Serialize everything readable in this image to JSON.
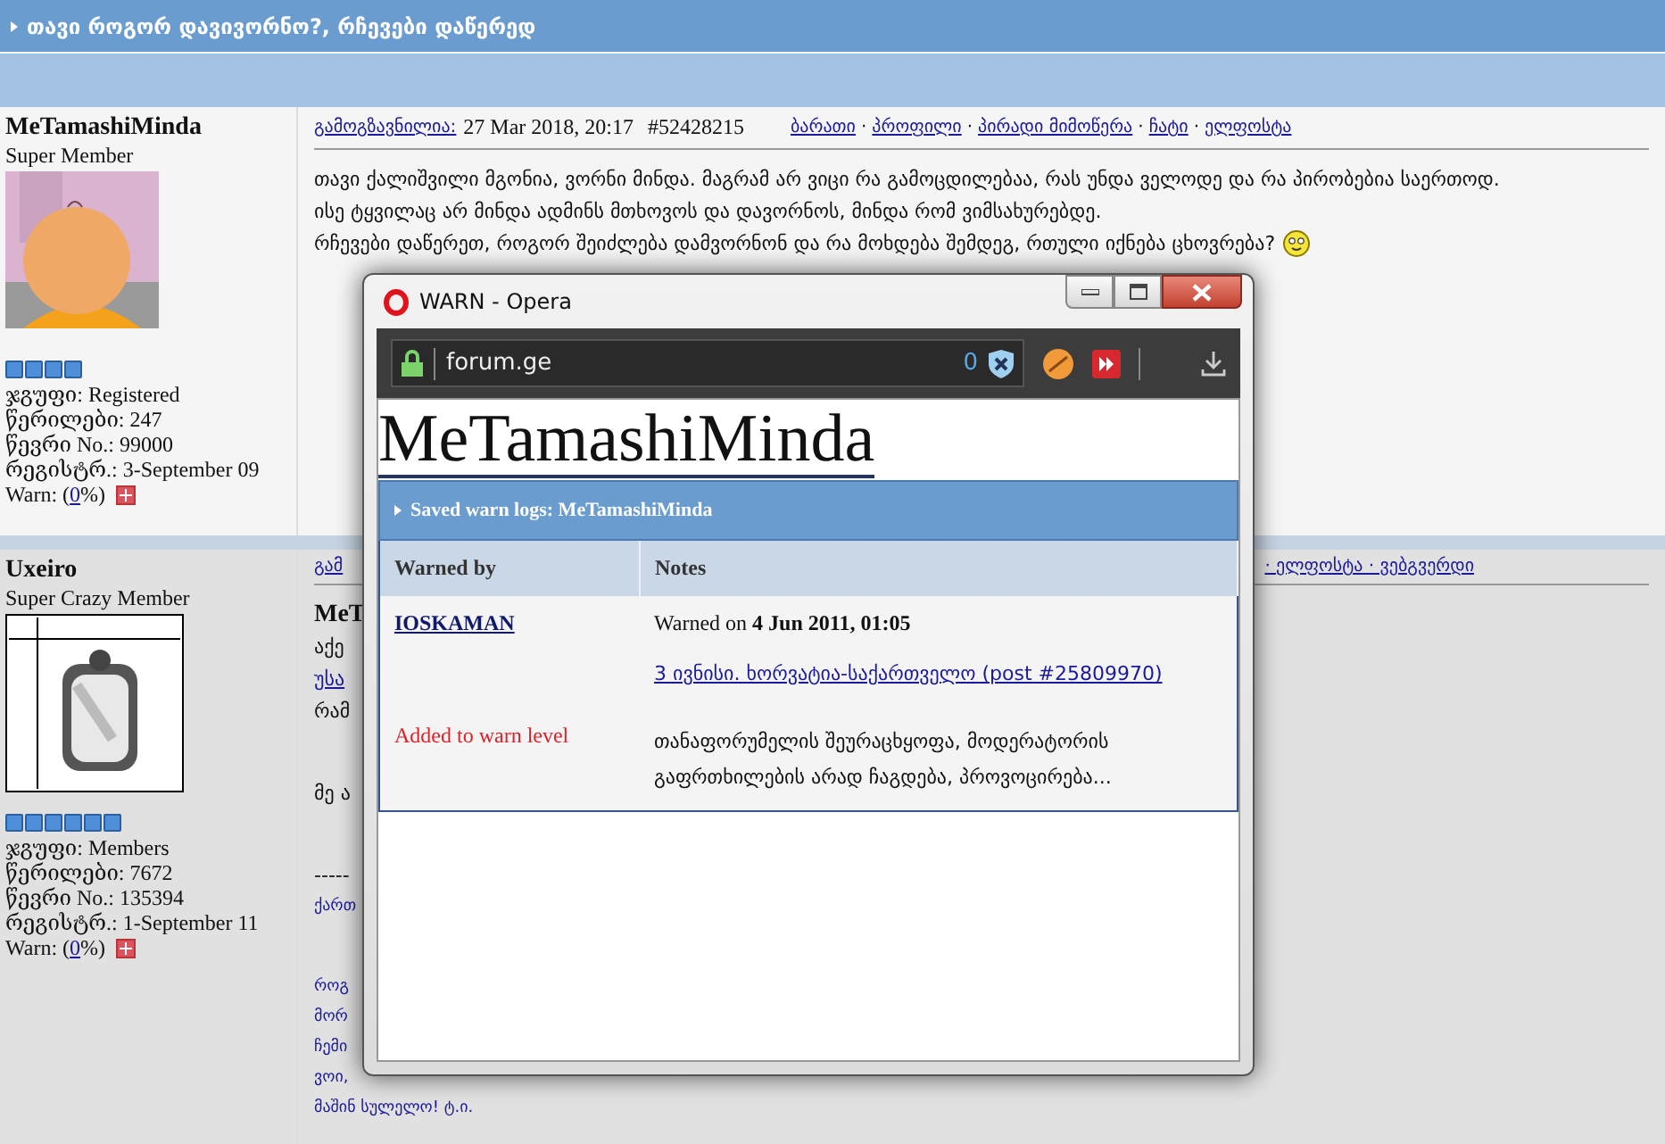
{
  "topic_title": "თავი როგორ დავივორნო?, რჩევები დაწერედ",
  "posts": [
    {
      "author": "MeTamashiMinda",
      "rank": "Super Member",
      "avatar": {
        "kind": "picture"
      },
      "rank_pips": {
        "stars": 4
      },
      "info": [
        "ჯგუფი: Registered",
        "წერილები: 247",
        "წევრი No.: 99000",
        "რეგისტრ.: 3-September 09"
      ],
      "warn": {
        "label": "Warn: (",
        "value": "0",
        "suffix": "%)"
      },
      "header": {
        "sent_label": "გამოგზავნილია:",
        "date": "27 Mar 2018, 20:17",
        "post_number": "#52428215",
        "links_separator": "·",
        "links": [
          "ბარათი",
          "პროფილი",
          "პირადი მიმოწერა",
          "ჩატი",
          "ელფოსტა"
        ]
      },
      "body": [
        "თავი ქალიშვილი მგონია, ვორნი მინდა. მაგრამ არ ვიცი რა გამოცდილებაა, რას უნდა ველოდე და რა პირობებია საერთოდ.",
        "ისე ტყვილაც არ მინდა ადმინს მთხოვოს და დავორნოს, მინდა რომ ვიმსახურებდე.",
        "რჩევები დაწერეთ, როგორ შეიძლება დამვორნონ და რა მოხდება შემდეგ, რთული იქნება ცხოვრება?"
      ]
    },
    {
      "author": "Uxeiro",
      "rank": "Super Crazy Member",
      "avatar": {
        "kind": "picture"
      },
      "rank_pips": {
        "stars": 6
      },
      "info": [
        "ჯგუფი: Members",
        "წერილები: 7672",
        "წევრი No.: 135394",
        "რეგისტრ.: 1-September 11"
      ],
      "warn": {
        "label": "Warn: (",
        "value": "0",
        "suffix": "%)"
      },
      "header_fragments": {
        "left": "გამ",
        "right": "· ელფოსტა · ვებგვერდი"
      },
      "body_blocks": [
        [
          {
            "kind": "bold",
            "text": "MeT"
          },
          {
            "kind": "plain",
            "text": "აქე"
          },
          {
            "kind": "link",
            "text": "უსა"
          },
          {
            "kind": "plain",
            "text": "რამ"
          }
        ],
        [
          {
            "kind": "plain",
            "text": "მე ა"
          }
        ],
        [
          {
            "kind": "plain",
            "text": "-----"
          },
          {
            "kind": "small",
            "text": "ქართ"
          }
        ],
        [
          {
            "kind": "small",
            "text": "როგ"
          },
          {
            "kind": "small",
            "text": "მორ"
          },
          {
            "kind": "small",
            "text": "ჩემი"
          },
          {
            "kind": "small",
            "text": "ვოი,"
          },
          {
            "kind": "small",
            "text": "მაშინ სულელო! ტ.ი."
          }
        ]
      ]
    }
  ],
  "popup": {
    "title": "WARN - Opera",
    "address": "forum.ge",
    "blocked_count": "0",
    "heading": "MeTamashiMinda",
    "band_title": "Saved warn logs: MeTamashiMinda",
    "columns": [
      "Warned by",
      "Notes"
    ],
    "rows": [
      {
        "warned_by": "IOSKAMAN",
        "action": "Added to warn level",
        "warned_on": "Warned on **4 Jun 2011, 01:05**",
        "post_link": "3 ივნისი. ხორვატია-საქართველო (post #25809970)",
        "note": "თანაფორუმელის შეურაცხყოფა, მოდერატორის გაფრთხილების არად ჩაგდება, პროვოცირება..."
      }
    ]
  }
}
